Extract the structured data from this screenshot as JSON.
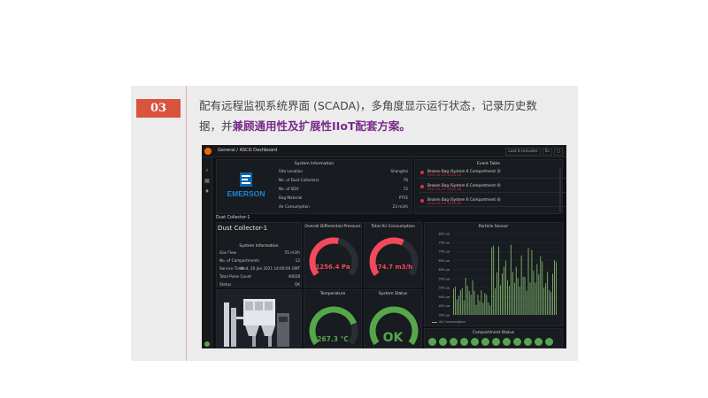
{
  "badge": "03",
  "caption": {
    "line1": "配有远程监视系统界面 (SCADA)，多角度显示运行状态，记录历史数",
    "line2_plain": "据，并",
    "line2_highlight": "兼顾通用性及扩展性IIoT配套方案。"
  },
  "dashboard": {
    "breadcrumb": "General / ASCO Dashboard",
    "topbar": {
      "time_range": "Last 6 minutes",
      "refresh": "5s"
    },
    "system_info": {
      "title": "System Information",
      "logo_text": "EMERSON",
      "rows": [
        {
          "label": "Site Location",
          "value": "Shanghai"
        },
        {
          "label": "No. of Dust Collectors",
          "value": "76"
        },
        {
          "label": "No. of SDV",
          "value": "72"
        },
        {
          "label": "Bag Material",
          "value": "PTFE"
        },
        {
          "label": "Air Consumption",
          "value": "23 m3/h"
        }
      ]
    },
    "event_table": {
      "title": "Event Table",
      "events": [
        {
          "text": "Broken Bag (System 6 Compartment 3)",
          "time": "2021-01-25 14:02:14"
        },
        {
          "text": "Broken Bag (System 6 Compartment 4)",
          "time": "2021-01-25 14:01:44"
        },
        {
          "text": "Broken Bag (System 6 Compartment 4)",
          "time": "2021-01-25 14:00:53"
        }
      ]
    },
    "section_title": "Dust Collector-1",
    "dust_collector": {
      "title": "Dust Collector-1",
      "sub_title": "System Information",
      "rows": [
        {
          "label": "Gas Flow",
          "value": "55 m3/h"
        },
        {
          "label": "No. of Compartments",
          "value": "12"
        },
        {
          "label": "Service Time",
          "value": "Wed, 20 Jan 2021 14:00:00 GMT"
        },
        {
          "label": "Total Pulse Count",
          "value": "40028"
        },
        {
          "label": "Status",
          "value": "OK"
        }
      ]
    },
    "pressure": {
      "title": "Overall Differential Pressure",
      "value": "1256.4 Pa",
      "fraction": 0.55,
      "color": "#f2495c"
    },
    "air": {
      "title": "Total Air Consumption",
      "value": "374.7 m3/h",
      "fraction": 0.6,
      "color": "#f2495c"
    },
    "temperature": {
      "title": "Temperature",
      "value": "267.3 °C",
      "fraction": 0.78,
      "color": "#56a64b"
    },
    "system_status": {
      "title": "System Status",
      "value": "OK",
      "color": "#56a64b"
    },
    "particle": {
      "title": "Particle Sensor",
      "legend": "Air Consumption",
      "y_ticks": [
        "800 µa",
        "750 µa",
        "700 µa",
        "650 µa",
        "600 µa",
        "550 µa",
        "500 µa",
        "450 µa",
        "400 µa",
        "350 µa"
      ]
    },
    "compartment_status": {
      "title": "Compartment Status",
      "count": 12,
      "color": "#56a64b"
    }
  }
}
